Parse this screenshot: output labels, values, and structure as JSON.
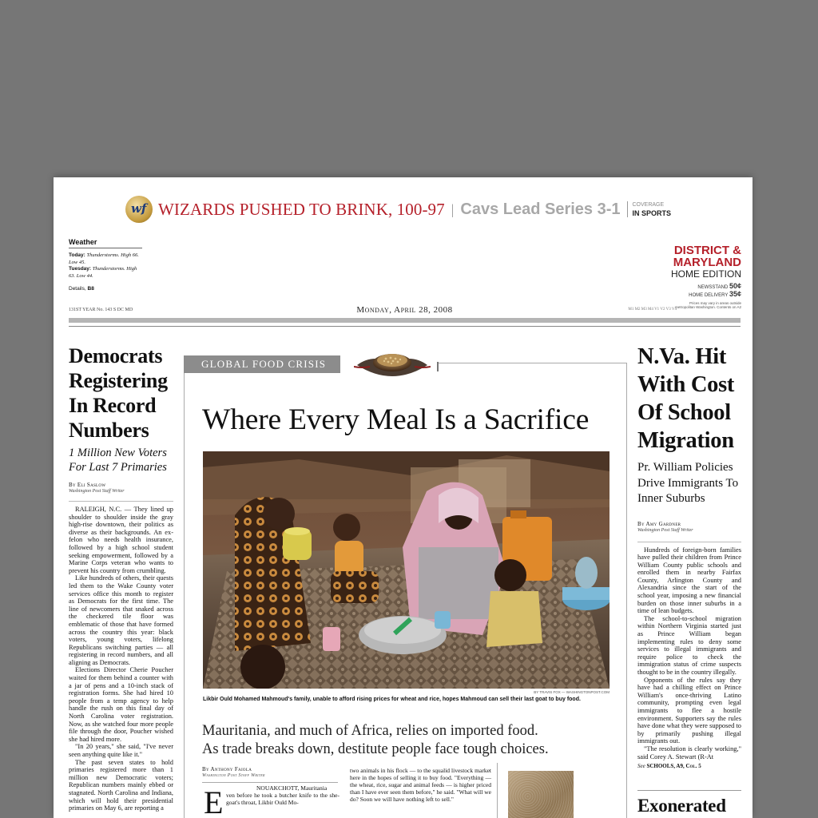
{
  "teaser": {
    "headline": "WIZARDS PUSHED TO BRINK, 100-97",
    "separator": "|",
    "subhead": "Cavs Lead Series 3-1",
    "coverage_line1": "COVERAGE",
    "coverage_line2": "IN SPORTS"
  },
  "weather": {
    "title": "Weather",
    "today_label": "Today:",
    "today_text": "Thunderstorms. High 66. Low 45.",
    "tuesday_label": "Tuesday:",
    "tuesday_text": "Thunderstorms. High 63. Low 44.",
    "details_label": "Details,",
    "details_page": "B8"
  },
  "edition": {
    "region_line1": "DISTRICT &",
    "region_line2": "MARYLAND",
    "name": "HOME EDITION",
    "newsstand_label": "NEWSSTAND",
    "newsstand_price": "50¢",
    "home_delivery_label": "HOME DELIVERY",
    "home_delivery_price": "35¢",
    "fine_print": "Prices may vary in areas outside metropolitan Washington. Contents on A2"
  },
  "dateline": {
    "left": "131ST YEAR  No. 143      S      DC      MD",
    "date": "Monday, April 28, 2008",
    "right": "M1  M2  M3  M4  V1  V2  V3  V4"
  },
  "left_story": {
    "headline": "Democrats Registering In Record Numbers",
    "deck": "1 Million New Voters For Last 7 Primaries",
    "byline": "By Eli Saslow",
    "staff": "Washington Post Staff Writer",
    "paragraphs": [
      "RALEIGH, N.C. — They lined up shoulder to shoulder inside the gray high-rise downtown, their politics as diverse as their backgrounds. An ex-felon who needs health insurance, followed by a high school student seeking empowerment, followed by a Marine Corps veteran who wants to prevent his country from crumbling.",
      "Like hundreds of others, their quests led them to the Wake County voter services office this month to register as Democrats for the first time. The line of newcomers that snaked across the checkered tile floor was emblematic of those that have formed across the country this year: black voters, young voters, lifelong Republicans switching parties — all registering in record numbers, and all aligning as Democrats.",
      "Elections Director Cherie Poucher waited for them behind a counter with a jar of pens and a 10-inch stack of registration forms. She had hired 10 people from a temp agency to help handle the rush on this final day of North Carolina voter registration. Now, as she watched four more people file through the door, Poucher wished she had hired more.",
      "\"In 20 years,\" she said, \"I've never seen anything quite like it.\"",
      "The past seven states to hold primaries registered more than 1 million new Democratic voters; Republican numbers mainly ebbed or stagnated. North Carolina and Indiana, which will hold their presidential primaries on May 6, are reporting a"
    ]
  },
  "center": {
    "kicker": "GLOBAL FOOD CRISIS",
    "headline": "Where Every Meal Is a Sacrifice",
    "photo_credit": "BY TRAVIS FOX — WASHINGTONPOST.COM",
    "caption": "Likbir Ould Mohamed Mahmoud's family, unable to afford rising prices for wheat and rice, hopes Mahmoud can sell their last goat to buy food.",
    "deck_line1": "Mauritania, and much of Africa, relies on imported food.",
    "deck_line2": "As trade breaks down, destitute people face tough choices.",
    "byline": "By Anthony Faiola",
    "staff": "Washington Post Staff Writer",
    "dateline": "NOUAKCHOTT, Mauritania",
    "dropcap": "E",
    "body_col1": "ven before he took a butcher knife to the she-goat's throat, Likbir Ould Mo-",
    "body_col2": "two animals in his flock — to the squalid livestock market here in the hopes of selling it to buy food. \"Everything — the wheat, rice, sugar and animal feeds — is higher priced than I have ever seen them before,\" he said. \"What will we do? Soon we will have nothing left to sell.\""
  },
  "right_story": {
    "headline": "N.Va. Hit With Cost Of School Migration",
    "deck": "Pr. William Policies Drive Immigrants To Inner Suburbs",
    "byline": "By Amy Gardner",
    "staff": "Washington Post Staff Writer",
    "paragraphs": [
      "Hundreds of foreign-born families have pulled their children from Prince William County public schools and enrolled them in nearby Fairfax County, Arlington County and Alexandria since the start of the school year, imposing a new financial burden on those inner suburbs in a time of lean budgets.",
      "The school-to-school migration within Northern Virginia started just as Prince William began implementing rules to deny some services to illegal immigrants and require police to check the immigration status of crime suspects thought to be in the country illegally.",
      "Opponents of the rules say they have had a chilling effect on Prince William's once-thriving Latino community, prompting even legal immigrants to flee a hostile environment. Supporters say the rules have done what they were supposed to by primarily pushing illegal immigrants out.",
      "\"The resolution is clearly working,\" said Corey A. Stewart (R-At"
    ],
    "see_prefix": "See",
    "see_ref": "SCHOOLS, A9, Col. 5"
  },
  "next_story": {
    "headline": "Exonerated"
  },
  "colors": {
    "accent_red": "#b5202a",
    "kicker_gray": "#8c8c8c",
    "background": "#767676"
  }
}
